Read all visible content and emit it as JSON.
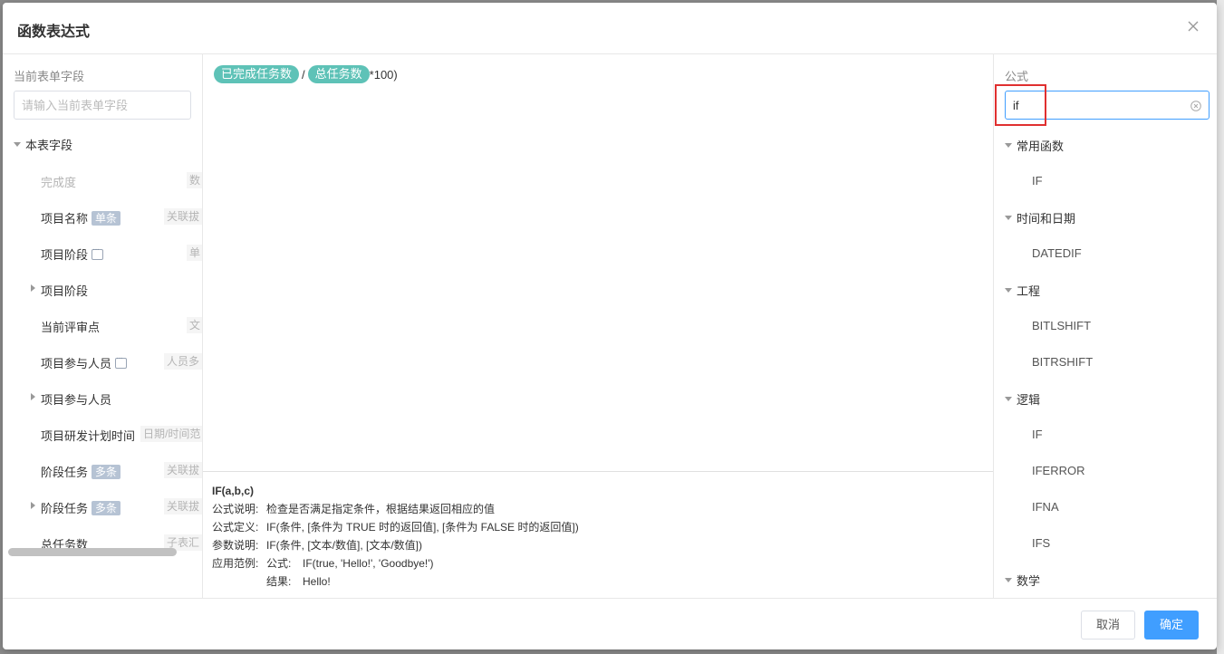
{
  "dialog": {
    "title": "函数表达式"
  },
  "left": {
    "label": "当前表单字段",
    "search_placeholder": "请输入当前表单字段",
    "tree_root": "本表字段",
    "fields": [
      {
        "name": "完成度",
        "type": "数",
        "disabled": true
      },
      {
        "name": "项目名称",
        "tag": "单条",
        "type": "关联拔"
      },
      {
        "name": "项目阶段",
        "dots": true,
        "type": "单"
      },
      {
        "name": "项目阶段",
        "expandable": true
      },
      {
        "name": "当前评审点",
        "type": "文"
      },
      {
        "name": "项目参与人员",
        "dots": true,
        "type": "人员多"
      },
      {
        "name": "项目参与人员",
        "expandable": true
      },
      {
        "name": "项目研发计划时间",
        "type": "日期/时间范"
      },
      {
        "name": "阶段任务",
        "tag": "多条",
        "type": "关联拔"
      },
      {
        "name": "阶段任务",
        "tag": "多条",
        "expandable": true,
        "type": "关联拔"
      },
      {
        "name": "总任务数",
        "type": "子表汇"
      }
    ]
  },
  "formula": {
    "chip1": "已完成任务数",
    "op1": "/",
    "chip2": "总任务数",
    "tail": "*100)"
  },
  "help": {
    "signature": "IF(a,b,c)",
    "desc_label": "公式说明:",
    "desc": "检查是否满足指定条件，根据结果返回相应的值",
    "def_label": "公式定义:",
    "def": "IF(条件, [条件为 TRUE 时的返回值], [条件为 FALSE 时的返回值])",
    "param_label": "参数说明:",
    "param": "IF(条件, [文本/数值], [文本/数值])",
    "example_label": "应用范例:",
    "example_formula_label": "公式:",
    "example_formula": "IF(true, 'Hello!', 'Goodbye!')",
    "example_result_label": "结果:",
    "example_result": "Hello!"
  },
  "right": {
    "label": "公式",
    "search_value": "if",
    "categories": [
      {
        "name": "常用函数",
        "functions": [
          "IF"
        ]
      },
      {
        "name": "时间和日期",
        "functions": [
          "DATEDIF"
        ]
      },
      {
        "name": "工程",
        "functions": [
          "BITLSHIFT",
          "BITRSHIFT"
        ]
      },
      {
        "name": "逻辑",
        "functions": [
          "IF",
          "IFERROR",
          "IFNA",
          "IFS"
        ]
      },
      {
        "name": "数学",
        "functions": []
      }
    ]
  },
  "footer": {
    "cancel_label": "取消",
    "ok_label": "确定"
  },
  "colors": {
    "accent": "#409eff",
    "chip": "#5ec2b7",
    "highlight": "#e03030"
  }
}
